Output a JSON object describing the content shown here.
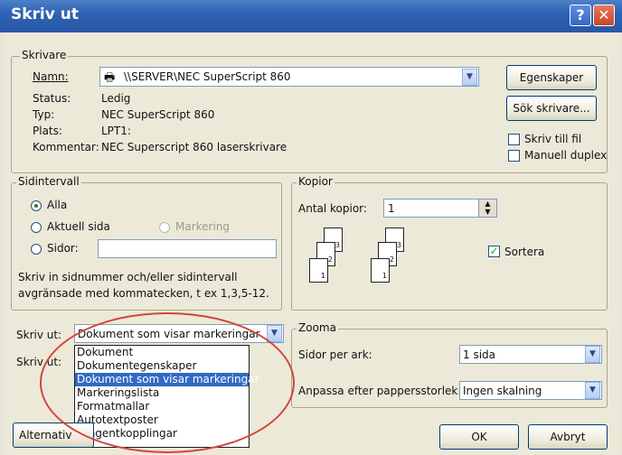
{
  "window": {
    "title": "Skriv ut"
  },
  "printer": {
    "group_label": "Skrivare",
    "name_label": "Namn:",
    "name_value": "\\\\SERVER\\NEC SuperScript 860",
    "status_label": "Status:",
    "status_value": "Ledig",
    "type_label": "Typ:",
    "type_value": "NEC SuperScript 860",
    "location_label": "Plats:",
    "location_value": "LPT1:",
    "comment_label": "Kommentar:",
    "comment_value": "NEC Superscript 860 laserskrivare",
    "properties_button": "Egenskaper",
    "find_printer_button": "Sök skrivare...",
    "print_to_file_label": "Skriv till fil",
    "manual_duplex_label": "Manuell duplex"
  },
  "page_range": {
    "group_label": "Sidintervall",
    "all_label": "Alla",
    "current_page_label": "Aktuell sida",
    "selection_label": "Markering",
    "pages_label": "Sidor:",
    "pages_value": "",
    "help_text_line1": "Skriv in sidnummer och/eller sidintervall",
    "help_text_line2": "avgränsade med kommatecken, t ex 1,3,5-12.",
    "selected": "Alla"
  },
  "copies": {
    "group_label": "Kopior",
    "count_label": "Antal kopior:",
    "count_value": "1",
    "collate_label": "Sortera",
    "collate_checked": true,
    "page_numbers": [
      "3",
      "2",
      "1"
    ]
  },
  "print_what": {
    "label": "Skriv ut:",
    "value": "Dokument som visar markeringar",
    "options": [
      "Dokument",
      "Dokumentegenskaper",
      "Dokument som visar markeringar",
      "Markeringslista",
      "Formatmallar",
      "Autotextposter",
      "Tangentkopplingar"
    ],
    "selected_index": 2
  },
  "print_range2": {
    "label": "Skriv ut:"
  },
  "zoom": {
    "group_label": "Zooma",
    "pages_per_sheet_label": "Sidor per ark:",
    "pages_per_sheet_value": "1 sida",
    "scale_label": "Anpassa efter pappersstorlek:",
    "scale_value": "Ingen skalning"
  },
  "footer": {
    "options_button": "Alternativ",
    "ok_button": "OK",
    "cancel_button": "Avbryt"
  },
  "colors": {
    "title_bar": "#2f62b3",
    "highlight": "#316ac5",
    "annotation_oval": "#d2453d"
  }
}
